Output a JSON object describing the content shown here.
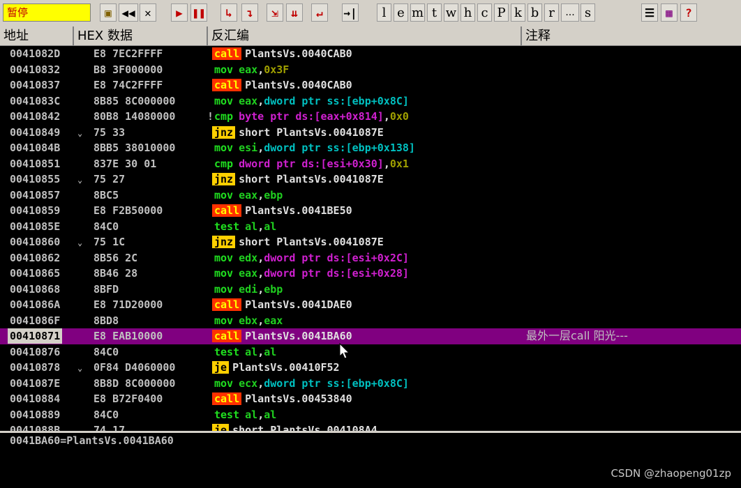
{
  "status": "暂停",
  "toolbar": {
    "buttons": [
      {
        "name": "open-icon",
        "glyph": "▣"
      },
      {
        "name": "rewind-icon",
        "glyph": "◀◀"
      },
      {
        "name": "close-icon",
        "glyph": "✕"
      },
      {
        "name": "run-icon",
        "glyph": "▶"
      },
      {
        "name": "pause-icon",
        "glyph": "❚❚"
      },
      {
        "name": "step-into-icon",
        "glyph": "↳"
      },
      {
        "name": "step-over-icon",
        "glyph": "↴"
      },
      {
        "name": "trace-into-icon",
        "glyph": "⇲"
      },
      {
        "name": "trace-over-icon",
        "glyph": "⇊"
      },
      {
        "name": "execute-till-return-icon",
        "glyph": "↵"
      },
      {
        "name": "goto-icon",
        "glyph": "→|"
      }
    ],
    "letters": [
      "l",
      "e",
      "m",
      "t",
      "w",
      "h",
      "c",
      "P",
      "k",
      "b",
      "r",
      "...",
      "s"
    ],
    "tail_buttons": [
      {
        "name": "list-icon",
        "glyph": "☰"
      },
      {
        "name": "grid-icon",
        "glyph": "▦"
      },
      {
        "name": "help-icon",
        "glyph": "?"
      }
    ]
  },
  "columns": {
    "address": "地址",
    "hex": "HEX 数据",
    "disasm": "反汇编",
    "comment": "注释"
  },
  "rows": [
    {
      "addr": "0041082D",
      "jump": "",
      "hex": "E8 7EC2FFFF",
      "op": "call",
      "args": [
        [
          "PlantsVs.0040CAB0",
          "txt"
        ]
      ],
      "comment": ""
    },
    {
      "addr": "00410832",
      "jump": "",
      "hex": "B8 3F000000",
      "op": "mov",
      "args": [
        [
          "eax",
          "reg"
        ],
        [
          ",",
          "txt"
        ],
        [
          "0x3F",
          "imm"
        ]
      ],
      "comment": ""
    },
    {
      "addr": "00410837",
      "jump": "",
      "hex": "E8 74C2FFFF",
      "op": "call",
      "args": [
        [
          "PlantsVs.0040CAB0",
          "txt"
        ]
      ],
      "comment": ""
    },
    {
      "addr": "0041083C",
      "jump": "",
      "hex": "8B85 8C000000",
      "op": "mov",
      "args": [
        [
          "eax",
          "reg"
        ],
        [
          ",",
          "txt"
        ],
        [
          "dword ptr ss:[ebp+0x8C]",
          "seg"
        ]
      ],
      "comment": ""
    },
    {
      "addr": "00410842",
      "jump": "",
      "hex": "80B8 14080000",
      "mark": "!",
      "op": "cmp",
      "args": [
        [
          "byte ptr ds:[eax+0x814]",
          "mem"
        ],
        [
          ",",
          "txt"
        ],
        [
          "0x0",
          "imm"
        ]
      ],
      "comment": ""
    },
    {
      "addr": "00410849",
      "jump": "⌄",
      "hex": "75 33",
      "op": "jnz",
      "args": [
        [
          "short PlantsVs.0041087E",
          "txt"
        ]
      ],
      "comment": ""
    },
    {
      "addr": "0041084B",
      "jump": "",
      "hex": "8BB5 38010000",
      "op": "mov",
      "args": [
        [
          "esi",
          "reg"
        ],
        [
          ",",
          "txt"
        ],
        [
          "dword ptr ss:[ebp+0x138]",
          "seg"
        ]
      ],
      "comment": ""
    },
    {
      "addr": "00410851",
      "jump": "",
      "hex": "837E 30 01",
      "op": "cmp",
      "args": [
        [
          "dword ptr ds:[esi+0x30]",
          "mem"
        ],
        [
          ",",
          "txt"
        ],
        [
          "0x1",
          "imm"
        ]
      ],
      "comment": ""
    },
    {
      "addr": "00410855",
      "jump": "⌄",
      "hex": "75 27",
      "op": "jnz",
      "args": [
        [
          "short PlantsVs.0041087E",
          "txt"
        ]
      ],
      "comment": ""
    },
    {
      "addr": "00410857",
      "jump": "",
      "hex": "8BC5",
      "op": "mov",
      "args": [
        [
          "eax",
          "reg"
        ],
        [
          ",",
          "txt"
        ],
        [
          "ebp",
          "reg"
        ]
      ],
      "comment": ""
    },
    {
      "addr": "00410859",
      "jump": "",
      "hex": "E8 F2B50000",
      "op": "call",
      "args": [
        [
          "PlantsVs.0041BE50",
          "txt"
        ]
      ],
      "comment": ""
    },
    {
      "addr": "0041085E",
      "jump": "",
      "hex": "84C0",
      "op": "test",
      "args": [
        [
          "al",
          "reg"
        ],
        [
          ",",
          "txt"
        ],
        [
          "al",
          "reg"
        ]
      ],
      "comment": ""
    },
    {
      "addr": "00410860",
      "jump": "⌄",
      "hex": "75 1C",
      "op": "jnz",
      "args": [
        [
          "short PlantsVs.0041087E",
          "txt"
        ]
      ],
      "comment": ""
    },
    {
      "addr": "00410862",
      "jump": "",
      "hex": "8B56 2C",
      "op": "mov",
      "args": [
        [
          "edx",
          "reg"
        ],
        [
          ",",
          "txt"
        ],
        [
          "dword ptr ds:[esi+0x2C]",
          "mem"
        ]
      ],
      "comment": ""
    },
    {
      "addr": "00410865",
      "jump": "",
      "hex": "8B46 28",
      "op": "mov",
      "args": [
        [
          "eax",
          "reg"
        ],
        [
          ",",
          "txt"
        ],
        [
          "dword ptr ds:[esi+0x28]",
          "mem"
        ]
      ],
      "comment": ""
    },
    {
      "addr": "00410868",
      "jump": "",
      "hex": "8BFD",
      "op": "mov",
      "args": [
        [
          "edi",
          "reg"
        ],
        [
          ",",
          "txt"
        ],
        [
          "ebp",
          "reg"
        ]
      ],
      "comment": ""
    },
    {
      "addr": "0041086A",
      "jump": "",
      "hex": "E8 71D20000",
      "op": "call",
      "args": [
        [
          "PlantsVs.0041DAE0",
          "txt"
        ]
      ],
      "comment": ""
    },
    {
      "addr": "0041086F",
      "jump": "",
      "hex": "8BD8",
      "op": "mov",
      "args": [
        [
          "ebx",
          "reg"
        ],
        [
          ",",
          "txt"
        ],
        [
          "eax",
          "reg"
        ]
      ],
      "comment": ""
    },
    {
      "addr": "00410871",
      "jump": "",
      "hex": "E8 EAB10000",
      "op": "call",
      "args": [
        [
          "PlantsVs.0041BA60",
          "txt"
        ]
      ],
      "comment": "最外一层call 阳光---",
      "selected": true
    },
    {
      "addr": "00410876",
      "jump": "",
      "hex": "84C0",
      "op": "test",
      "args": [
        [
          "al",
          "reg"
        ],
        [
          ",",
          "txt"
        ],
        [
          "al",
          "reg"
        ]
      ],
      "comment": ""
    },
    {
      "addr": "00410878",
      "jump": "⌄",
      "hex": "0F84 D4060000",
      "op": "je",
      "args": [
        [
          "PlantsVs.00410F52",
          "txt"
        ]
      ],
      "comment": ""
    },
    {
      "addr": "0041087E",
      "jump": "",
      "hex": "8B8D 8C000000",
      "op": "mov",
      "args": [
        [
          "ecx",
          "reg"
        ],
        [
          ",",
          "txt"
        ],
        [
          "dword ptr ss:[ebp+0x8C]",
          "seg"
        ]
      ],
      "comment": ""
    },
    {
      "addr": "00410884",
      "jump": "",
      "hex": "E8 B72F0400",
      "op": "call",
      "args": [
        [
          "PlantsVs.00453840",
          "txt"
        ]
      ],
      "comment": ""
    },
    {
      "addr": "00410889",
      "jump": "",
      "hex": "84C0",
      "op": "test",
      "args": [
        [
          "al",
          "reg"
        ],
        [
          ",",
          "txt"
        ],
        [
          "al",
          "reg"
        ]
      ],
      "comment": ""
    },
    {
      "addr": "0041088B",
      "jump": "",
      "hex": "74 17",
      "op": "je",
      "args": [
        [
          "short PlantsVs.004108A4",
          "txt"
        ]
      ],
      "comment": ""
    }
  ],
  "info": "0041BA60=PlantsVs.0041BA60",
  "watermark": "CSDN @zhaopeng01zp"
}
